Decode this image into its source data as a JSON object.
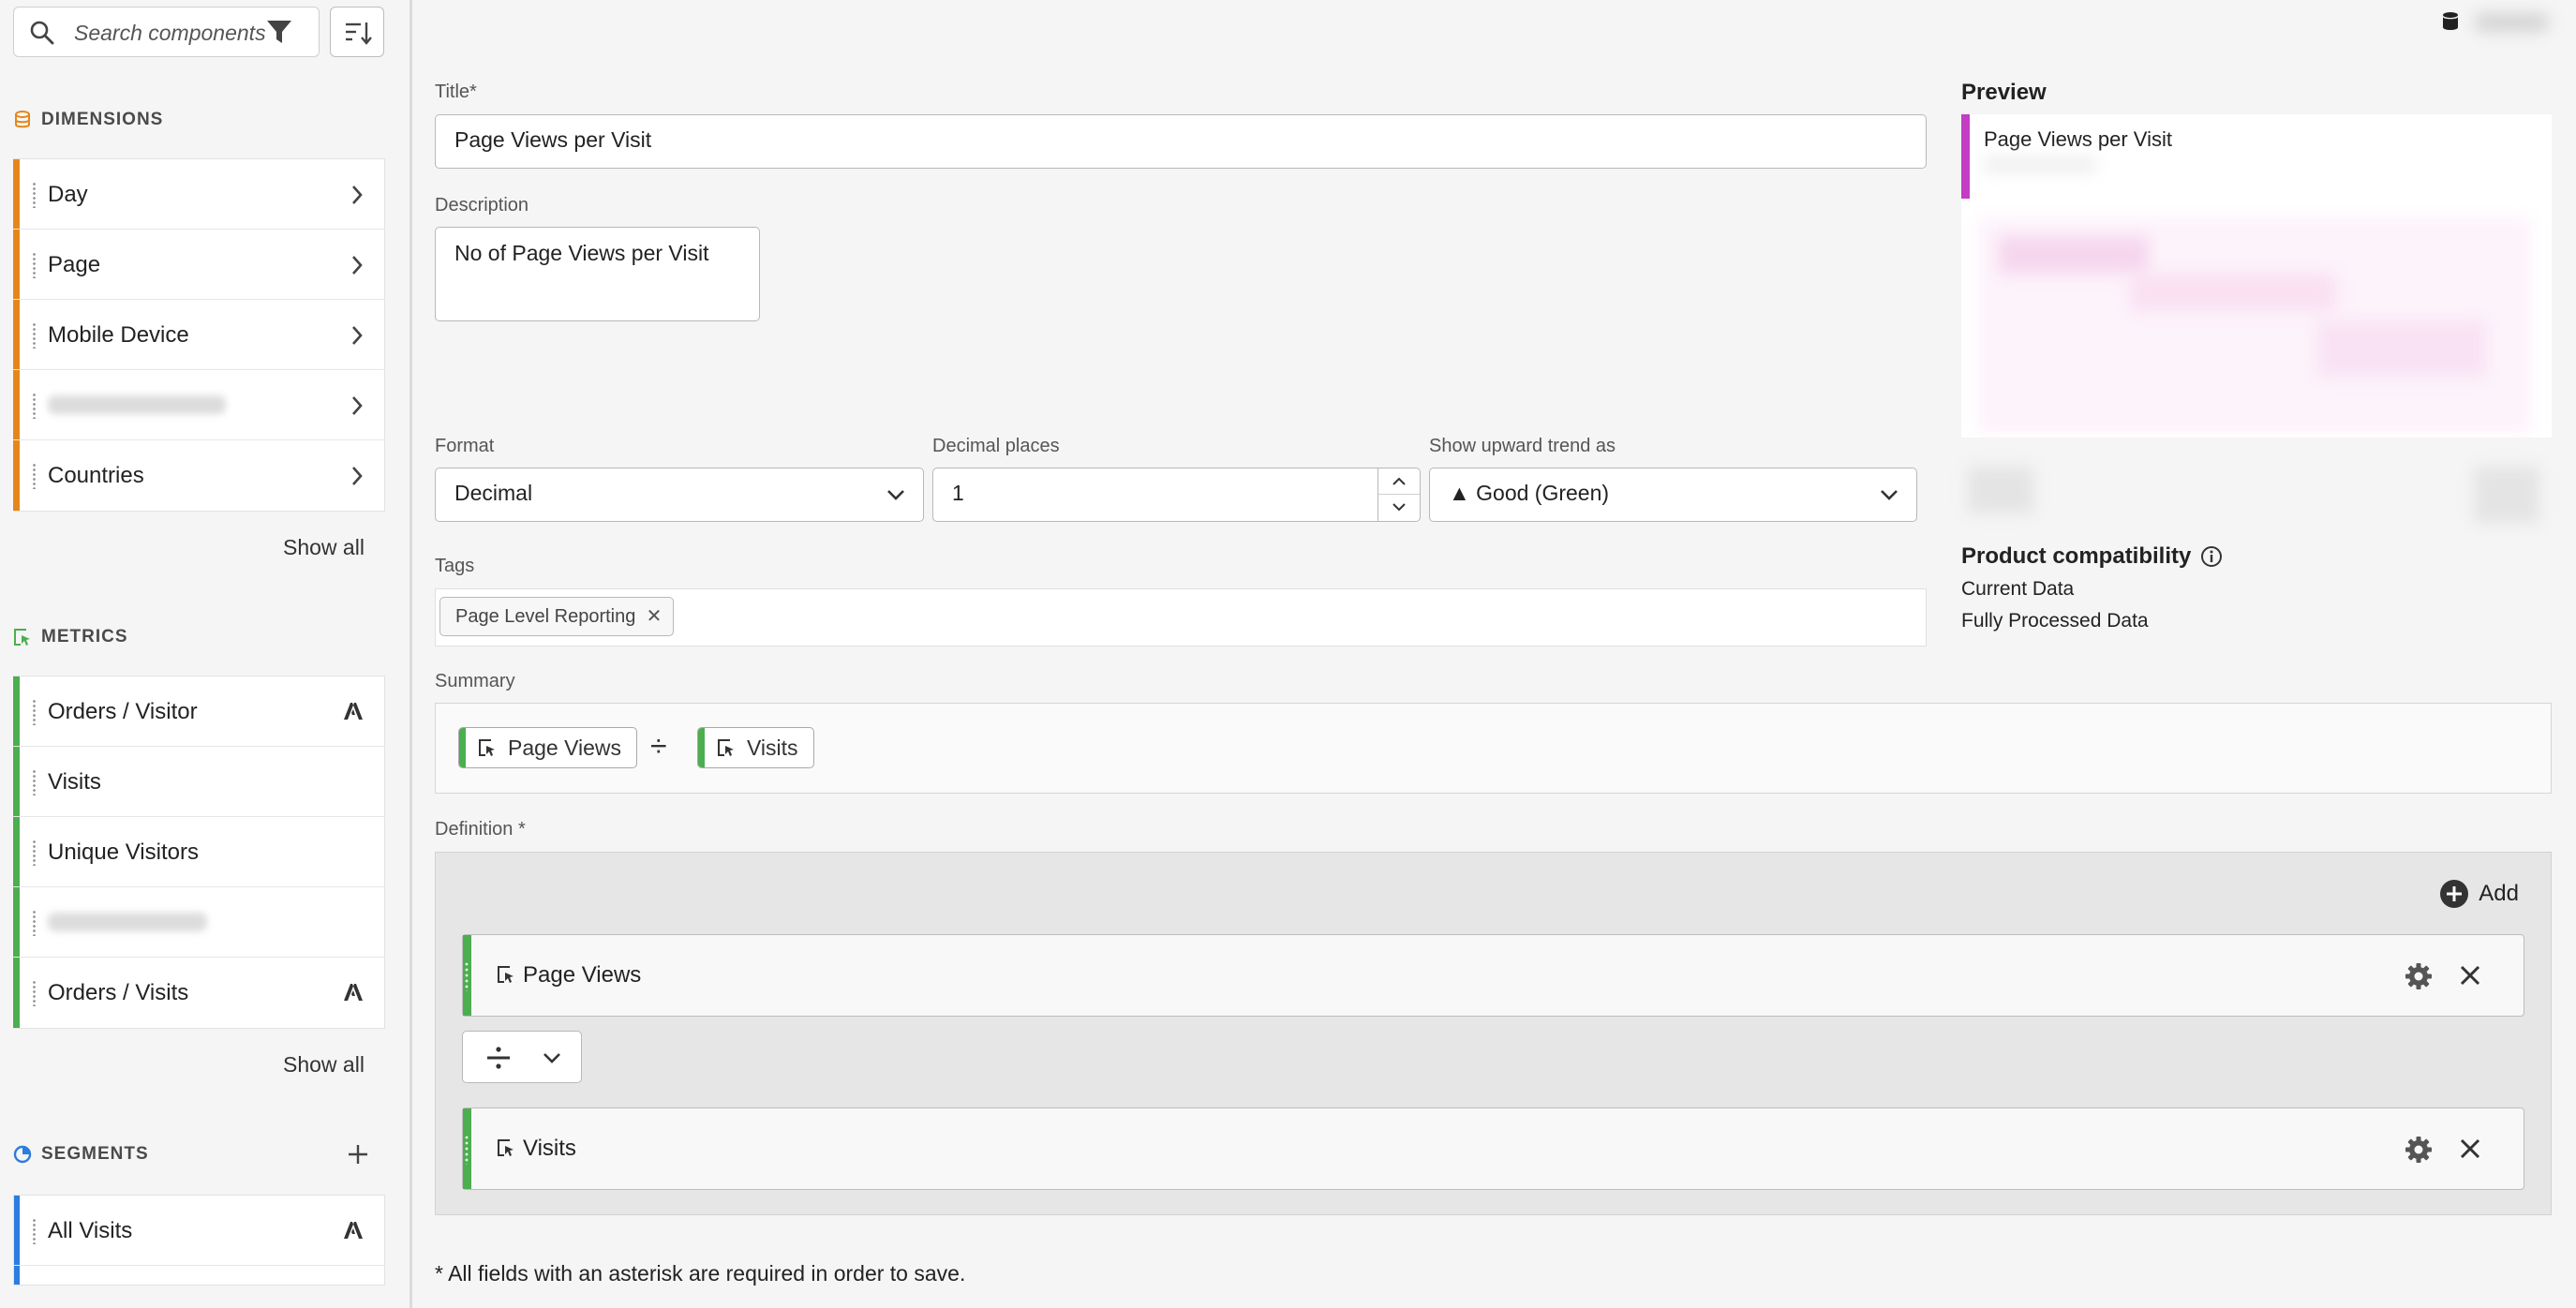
{
  "sidebar": {
    "search": {
      "placeholder": "Search components"
    },
    "dimensions": {
      "header": "DIMENSIONS",
      "items": [
        {
          "label": "Day"
        },
        {
          "label": "Page"
        },
        {
          "label": "Mobile Device"
        },
        {
          "label": ""
        },
        {
          "label": "Countries"
        }
      ],
      "show_all": "Show all"
    },
    "metrics": {
      "header": "METRICS",
      "items": [
        {
          "label": "Orders / Visitor"
        },
        {
          "label": "Visits"
        },
        {
          "label": "Unique Visitors"
        },
        {
          "label": ""
        },
        {
          "label": "Orders / Visits"
        }
      ],
      "show_all": "Show all"
    },
    "segments": {
      "header": "SEGMENTS",
      "items": [
        {
          "label": "All Visits"
        }
      ]
    }
  },
  "form": {
    "title_label": "Title",
    "title_required": "*",
    "title_value": "Page Views per Visit",
    "description_label": "Description",
    "description_value": "No of Page Views per Visit",
    "format_label": "Format",
    "format_value": "Decimal",
    "decimal_label": "Decimal places",
    "decimal_value": "1",
    "trend_label": "Show upward trend as",
    "trend_value": "▲ Good (Green)",
    "tags_label": "Tags",
    "tags": [
      {
        "label": "Page Level Reporting"
      }
    ],
    "summary_label": "Summary",
    "summary": {
      "left": "Page Views",
      "operator": "÷",
      "right": "Visits"
    },
    "definition_label": "Definition",
    "definition_required": "*",
    "add_label": "Add",
    "definition_rows": [
      {
        "label": "Page Views"
      },
      {
        "label": "Visits"
      }
    ],
    "footer_required": "*",
    "footer_note": "All fields with an asterisk are required in order to save."
  },
  "preview": {
    "heading": "Preview",
    "card_title": "Page Views per Visit",
    "compat_heading": "Product compatibility",
    "compat_items": [
      "Current Data",
      "Fully Processed Data"
    ]
  },
  "colors": {
    "dimension": "#e68619",
    "metric": "#4cae4f",
    "segment": "#2b7de0",
    "preview_accent": "#c43dc4"
  },
  "icons": [
    "search-icon",
    "filter-icon",
    "sort-icon",
    "chevron-right-icon",
    "adobe-icon",
    "plus-icon",
    "info-icon",
    "gear-icon",
    "close-icon",
    "divide-icon",
    "chevron-down-icon",
    "metric-icon",
    "database-icon"
  ]
}
